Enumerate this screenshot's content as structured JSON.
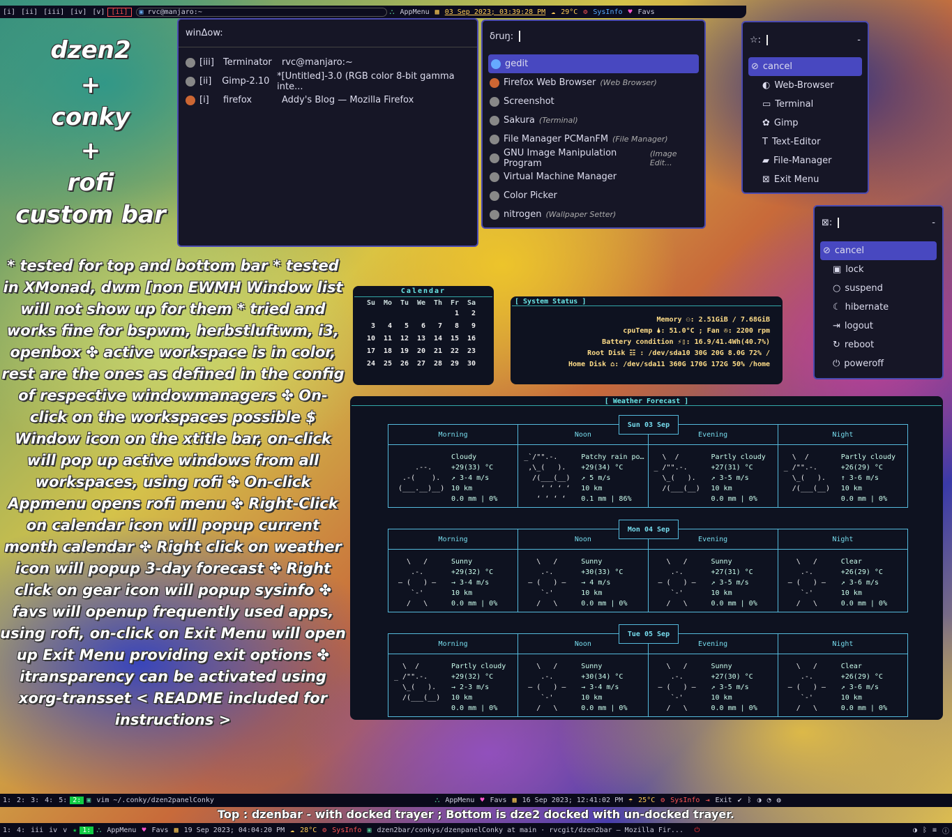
{
  "topbar": {
    "workspaces": [
      "[i]",
      "[ii]",
      "[iii]",
      "[iv]",
      "[v]",
      "[ii]"
    ],
    "window": "rvc@manjaro:~",
    "appmenu": "AppMenu",
    "datetime": "03 Sep 2023; 03:39:28 PM",
    "temp": "29°C",
    "sysinfo": "SysInfo",
    "favs": "Favs"
  },
  "headline": [
    "dzen2",
    "+",
    "conky",
    "+",
    "rofi",
    "custom bar"
  ],
  "description": "* tested for top and bottom bar * tested in XMonad, dwm [non EWMH Window list will not show up for them * tried and works fine for bspwm, herbstluftwm, i3, openbox ✤ active workspace is in color, rest are the ones as defined in the config of respective windowmanagers ✤ On-click on the workspaces possible $ Window icon on the xtitle bar, on-click will pop up active windows from all workspaces, using rofi ✤ On-click Appmenu opens rofi menu ✤ Right-Click on calendar icon will popup current month calendar ✤ Right click on weather icon will popup 3-day forecast ✤ Right click on gear icon will popup sysinfo ✤ favs will openup frequently used apps, using rofi, on-click on Exit Menu will open up Exit Menu providing exit options ✤ itransparency can be activated using xorg-transset < README included for instructions >",
  "window_switcher": {
    "prompt": "winΔow:",
    "items": [
      {
        "ws": "[iii]",
        "app": "Terminator",
        "title": "rvc@manjaro:~"
      },
      {
        "ws": "[ii]",
        "app": "Gimp-2.10",
        "title": "*[Untitled]-3.0 (RGB color 8-bit gamma inte..."
      },
      {
        "ws": "[i]",
        "app": "firefox",
        "title": "Addy's Blog — Mozilla Firefox"
      }
    ]
  },
  "run": {
    "prompt": "δruŋ:",
    "items": [
      {
        "name": "gedit",
        "cat": ""
      },
      {
        "name": "Firefox Web Browser",
        "cat": "(Web Browser)"
      },
      {
        "name": "Screenshot",
        "cat": ""
      },
      {
        "name": "Sakura",
        "cat": "(Terminal)"
      },
      {
        "name": "File Manager PCManFM",
        "cat": "(File Manager)"
      },
      {
        "name": "GNU Image Manipulation Program",
        "cat": "(Image Edit..."
      },
      {
        "name": "Virtual Machine Manager",
        "cat": ""
      },
      {
        "name": "Color Picker",
        "cat": ""
      },
      {
        "name": "nitrogen",
        "cat": "(Wallpaper Setter)"
      }
    ]
  },
  "favs_menu": {
    "prompt": "☆:",
    "dash": "-",
    "items": [
      "cancel",
      "Web-Browser",
      "Terminal",
      "Gimp",
      "Text-Editor",
      "File-Manager",
      "Exit Menu"
    ]
  },
  "exit_menu": {
    "prompt": ":",
    "dash": "-",
    "items": [
      "cancel",
      "lock",
      "suspend",
      "hibernate",
      "logout",
      "reboot",
      "poweroff"
    ]
  },
  "calendar": {
    "title": "Calendar",
    "days": [
      "Su",
      "Mo",
      "Tu",
      "We",
      "Th",
      "Fr",
      "Sa"
    ],
    "rows": [
      [
        "",
        "",
        "",
        "",
        "",
        "1",
        "2"
      ],
      [
        "3",
        "4",
        "5",
        "6",
        "7",
        "8",
        "9"
      ],
      [
        "10",
        "11",
        "12",
        "13",
        "14",
        "15",
        "16"
      ],
      [
        "17",
        "18",
        "19",
        "20",
        "21",
        "22",
        "23"
      ],
      [
        "24",
        "25",
        "26",
        "27",
        "28",
        "29",
        "30"
      ]
    ]
  },
  "sysstatus": {
    "title": "[ System Status ]",
    "lines": [
      "Memory ⚇: 2.51GiB / 7.68GiB",
      "cpuTemp 🌢: 51.0°C ; Fan  ✇: 2200 rpm",
      "Battery condition ⚡▯: 16.9/41.4Wh(40.7%)",
      "Root Disk ☷  : /dev/sda10       30G   20G  8.0G  72% /",
      "Home Disk ⌂: /dev/sda11      360G  170G  172G  50% /home"
    ]
  },
  "weather": {
    "title": "[ Weather Forecast ]",
    "periods": [
      "Morning",
      "Noon",
      "Evening",
      "Night"
    ],
    "days": [
      {
        "day": "Sun 03 Sep",
        "cells": [
          {
            "art": "\n     .--.\n  .-(    ).\n (___.__)__)",
            "info": "Cloudy\n+29(33) °C\n↗ 3-4 m/s\n10 km\n0.0 mm | 0%"
          },
          {
            "art": "_`/\"\".-.\n ,\\_(   ).\n  /(___(__)\n    ‘ ‘ ‘ ‘\n   ‘ ‘ ‘ ‘",
            "info": "Patchy rain po…\n+29(34) °C\n↗ 5 m/s\n10 km\n0.1 mm | 86%"
          },
          {
            "art": "  \\  /\n_ /\"\".-.\n  \\_(   ).\n  /(___(__)",
            "info": "Partly cloudy\n+27(31) °C\n↗ 3-5 m/s\n10 km\n0.0 mm | 0%"
          },
          {
            "art": "  \\  /\n_ /\"\".-.\n  \\_(   ).\n  /(___(__)",
            "info": "Partly cloudy\n+26(29) °C\n↑ 3-6 m/s\n10 km\n0.0 mm | 0%"
          }
        ]
      },
      {
        "day": "Mon 04 Sep",
        "cells": [
          {
            "art": "   \\   /\n    .-.\n ‒ (   ) ‒\n    `-'\n   /   \\",
            "info": "Sunny\n+29(32) °C\n→ 3-4 m/s\n10 km\n0.0 mm | 0%"
          },
          {
            "art": "   \\   /\n    .-.\n ‒ (   ) ‒\n    `-'\n   /   \\",
            "info": "Sunny\n+30(33) °C\n→ 4 m/s\n10 km\n0.0 mm | 0%"
          },
          {
            "art": "   \\   /\n    .-.\n ‒ (   ) ‒\n    `-'\n   /   \\",
            "info": "Sunny\n+27(31) °C\n↗ 3-5 m/s\n10 km\n0.0 mm | 0%"
          },
          {
            "art": "   \\   /\n    .-.\n ‒ (   ) ‒\n    `-'\n   /   \\",
            "info": "Clear\n+26(29) °C\n↗ 3-6 m/s\n10 km\n0.0 mm | 0%"
          }
        ]
      },
      {
        "day": "Tue 05 Sep",
        "cells": [
          {
            "art": "  \\  /\n_ /\"\".-.\n  \\_(   ).\n  /(___(__)",
            "info": "Partly cloudy\n+29(32) °C\n→ 2-3 m/s\n10 km\n0.0 mm | 0%"
          },
          {
            "art": "   \\   /\n    .-.\n ‒ (   ) ‒\n    `-'\n   /   \\",
            "info": "Sunny\n+30(34) °C\n→ 3-4 m/s\n10 km\n0.0 mm | 0%"
          },
          {
            "art": "   \\   /\n    .-.\n ‒ (   ) ‒\n    `-'\n   /   \\",
            "info": "Sunny\n+27(30) °C\n↗ 3-5 m/s\n10 km\n0.0 mm | 0%"
          },
          {
            "art": "   \\   /\n    .-.\n ‒ (   ) ‒\n    `-'\n   /   \\",
            "info": "Clear\n+26(29) °C\n↗ 3-6 m/s\n10 km\n0.0 mm | 0%"
          }
        ]
      }
    ]
  },
  "bar2": {
    "workspaces": [
      "1:",
      "2:",
      "3:",
      "4:",
      "5:",
      "2:"
    ],
    "window": "vim ~/.conky/dzen2panelConky",
    "appmenu": "AppMenu",
    "favs": "Favs",
    "datetime": "16 Sep 2023; 12:41:02 PM",
    "temp": "25°C",
    "sysinfo": "SysInfo",
    "exit": "Exit"
  },
  "caption": "Top : dzenbar - with docked trayer ; Bottom is dze2 docked with un-docked trayer.",
  "bar3": {
    "workspaces": [
      "1:",
      "4:",
      "iii",
      "iv",
      "v",
      "1:"
    ],
    "appmenu": "AppMenu",
    "favs": "Favs",
    "datetime": "19 Sep 2023; 04:04:20 PM",
    "temp": "28°C",
    "sysinfo": "SysInfo",
    "window": "dzen2bar/conkys/dzenpanelConky at main · rvcgit/dzen2bar — Mozilla Fir..."
  },
  "colors": {
    "accent": "#4848c0",
    "active_ws": "#ff5050",
    "cyan": "#6ce6e6"
  }
}
